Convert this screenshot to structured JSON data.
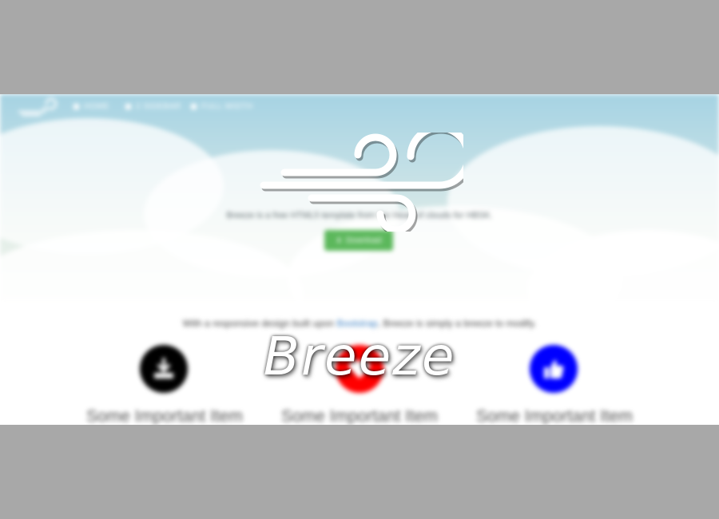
{
  "nav": {
    "items": [
      {
        "label": "HOME",
        "icon": "home-icon"
      },
      {
        "label": "2 SIDEBAR",
        "icon": "sidebar-icon"
      },
      {
        "label": "FULL WIDTH",
        "icon": "fullwidth-icon"
      }
    ]
  },
  "hero": {
    "logo_icon": "wind-icon",
    "tagline": "Breeze is a free HTML5 template from the Head of clouds for HBSK.",
    "download_label": "Download",
    "download_icon": "download-icon"
  },
  "intro": {
    "before": "With a responsive design built upon ",
    "link": "Bootstrap",
    "after": ", Breeze is simply a breeze to modify."
  },
  "features": [
    {
      "title": "Some Important Item",
      "icon": "download-icon",
      "color": "#000000"
    },
    {
      "title": "Some Important Item",
      "icon": "heart-icon",
      "color": "#ff0000"
    },
    {
      "title": "Some Important Item",
      "icon": "thumbs-up-icon",
      "color": "#0000ff"
    }
  ],
  "brand": {
    "title": "Breeze"
  },
  "colors": {
    "download_button": "#5cb85c",
    "link": "#3e82c4",
    "letterbox": "#a8a8a8",
    "sky_top": "#a6d3e3"
  }
}
